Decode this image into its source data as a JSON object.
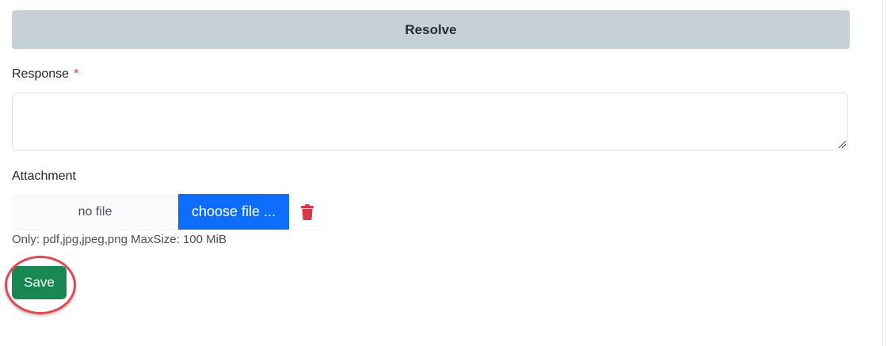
{
  "section": {
    "title": "Resolve"
  },
  "response": {
    "label": "Response",
    "required_marker": "*",
    "value": ""
  },
  "attachment": {
    "label": "Attachment",
    "file_name": "no file",
    "choose_label": "choose file ...",
    "hint": "Only: pdf,jpg,jpeg,png MaxSize: 100 MiB"
  },
  "actions": {
    "save_label": "Save"
  },
  "colors": {
    "header_bg": "#c5d0d8",
    "choose_button": "#0d6efd",
    "save_button": "#198754",
    "delete_icon": "#dc3545",
    "required_star": "#dc3545",
    "highlight_ring": "#e8464e"
  },
  "icons": {
    "delete": "trash-icon",
    "resize": "resize-grip-icon"
  }
}
